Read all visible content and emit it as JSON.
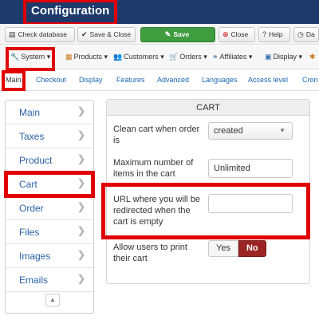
{
  "header": {
    "title": "Configuration"
  },
  "toolbar": {
    "check_database": "Check database",
    "save_close": "Save & Close",
    "save": "Save",
    "close": "Close",
    "help": "Help",
    "dashboard": "Da"
  },
  "menubar": {
    "items": [
      {
        "label": "System",
        "icon": "wrench-icon"
      },
      {
        "label": "Products",
        "icon": "products-icon"
      },
      {
        "label": "Customers",
        "icon": "customers-icon"
      },
      {
        "label": "Orders",
        "icon": "orders-icon"
      },
      {
        "label": "Affiliates",
        "icon": "affiliates-icon"
      },
      {
        "label": "Display",
        "icon": "display-icon"
      }
    ]
  },
  "tabs": [
    "Main",
    "Checkout",
    "Display",
    "Features",
    "Advanced",
    "Languages",
    "Access level",
    "Cron"
  ],
  "sidebar": {
    "items": [
      "Main",
      "Taxes",
      "Product",
      "Cart",
      "Order",
      "Files",
      "Images",
      "Emails"
    ]
  },
  "panel": {
    "title": "CART",
    "clean_cart_label": "Clean cart when order is",
    "clean_cart_value": "created",
    "max_items_label": "Maximum number of items in the cart",
    "max_items_value": "Unlimited",
    "redirect_label": "URL where you will be redirected when the cart is empty",
    "redirect_value": "",
    "print_label": "Allow users to print their cart",
    "yes": "Yes",
    "no": "No"
  }
}
